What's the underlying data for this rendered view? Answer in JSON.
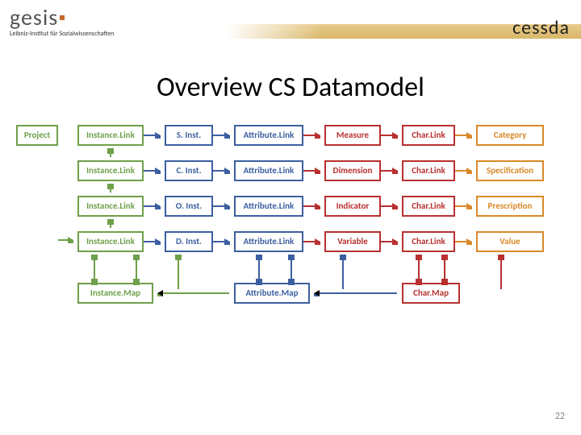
{
  "header": {
    "left_logo_main": "gesis",
    "left_logo_sub": "Leibniz-Institut für Sozialwissenschaften",
    "right_logo": "cessda"
  },
  "title": "Overview CS Datamodel",
  "project_label": "Project",
  "rows": [
    {
      "il": "Instance.Link",
      "inst": "S. Inst.",
      "al": "Attribute.Link",
      "attr": "Measure",
      "cl": "Char.Link",
      "char": "Category"
    },
    {
      "il": "Instance.Link",
      "inst": "C. Inst.",
      "al": "Attribute.Link",
      "attr": "Dimension",
      "cl": "Char.Link",
      "char": "Specification"
    },
    {
      "il": "Instance.Link",
      "inst": "O. Inst.",
      "al": "Attribute.Link",
      "attr": "Indicator",
      "cl": "Char.Link",
      "char": "Prescription"
    },
    {
      "il": "Instance.Link",
      "inst": "D. Inst.",
      "al": "Attribute.Link",
      "attr": "Variable",
      "cl": "Char.Link",
      "char": "Value"
    }
  ],
  "maps": {
    "instance": "Instance.Map",
    "attribute": "Attribute.Map",
    "char": "Char.Map"
  },
  "page_number": "22",
  "colors": {
    "green": "#6fa04a",
    "blue": "#3c5fa0",
    "red": "#b83030",
    "orange": "#d98a2a"
  }
}
